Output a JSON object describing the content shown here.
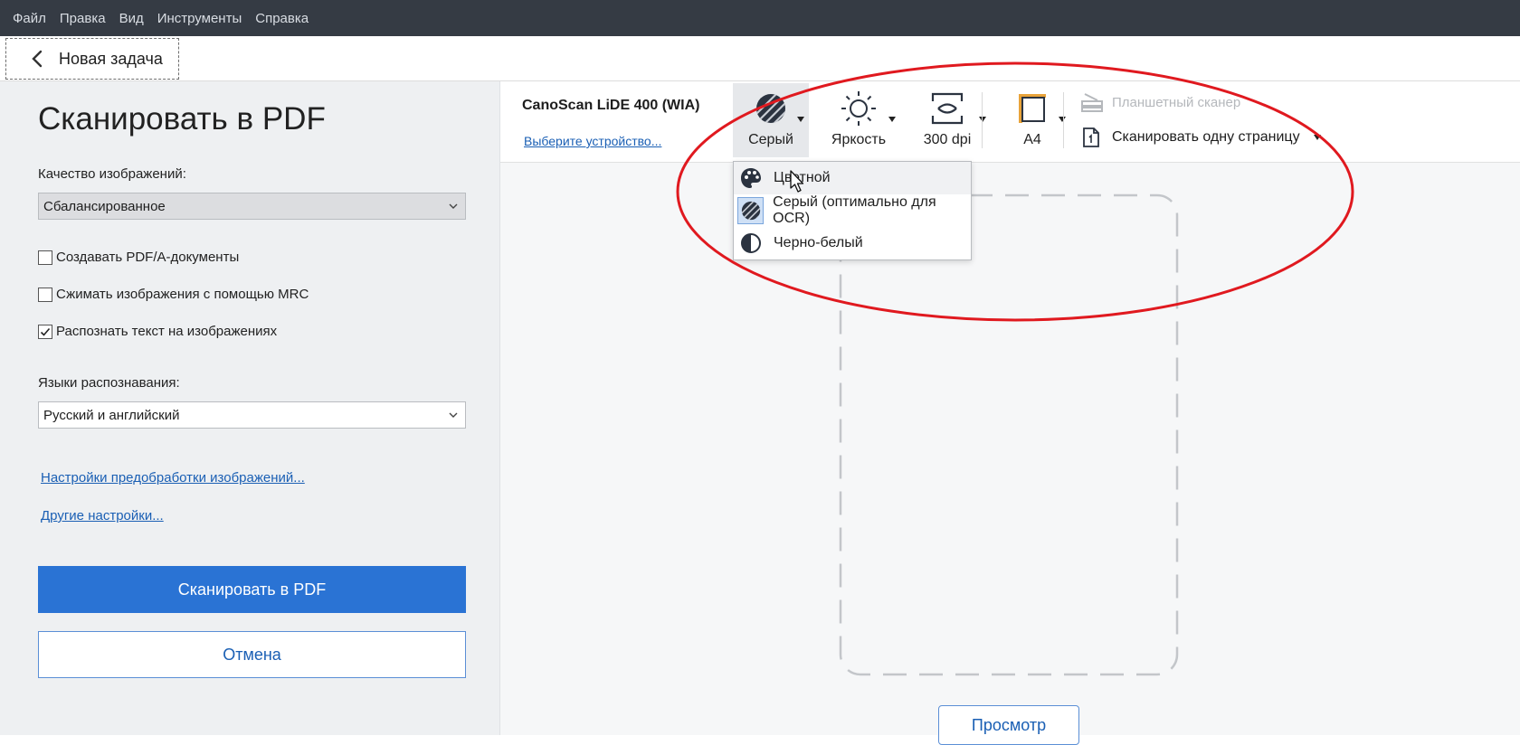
{
  "menu": [
    "Файл",
    "Правка",
    "Вид",
    "Инструменты",
    "Справка"
  ],
  "task": {
    "back_label": "Новая задача"
  },
  "left_panel": {
    "title": "Сканировать в PDF",
    "quality_label": "Качество изображений:",
    "quality_value": "Сбалансированное",
    "checkboxes": [
      {
        "label": "Создавать PDF/A-документы",
        "checked": false
      },
      {
        "label": "Сжимать изображения с помощью MRC",
        "checked": false
      },
      {
        "label": "Распознать текст на изображениях",
        "checked": true
      }
    ],
    "languages_label": "Языки распознавания:",
    "languages_value": "Русский и английский",
    "link_preprocessing": "Настройки предобработки изображений...",
    "link_other": "Другие настройки...",
    "scan_button": "Сканировать в PDF",
    "cancel_button": "Отмена"
  },
  "toolbar": {
    "device_name": "CanoScan LiDE 400 (WIA)",
    "device_link": "Выберите устройство...",
    "color_label": "Серый",
    "brightness_label": "Яркость",
    "dpi_label": "300 dpi",
    "paper_label": "A4",
    "flatbed_label": "Планшетный сканер",
    "scan_mode_label": "Сканировать одну страницу"
  },
  "color_menu": {
    "items": [
      {
        "label": "Цветной",
        "icon": "palette-icon",
        "state": "hover"
      },
      {
        "label": "Серый (оптимально для OCR)",
        "icon": "grey-hatch-icon",
        "state": "selected"
      },
      {
        "label": "Черно-белый",
        "icon": "half-circle-icon",
        "state": "normal"
      }
    ]
  },
  "preview": {
    "button_label": "Просмотр"
  },
  "colors": {
    "accent": "#2a73d4",
    "menubar": "#353b44",
    "annotation": "#e0191f"
  }
}
